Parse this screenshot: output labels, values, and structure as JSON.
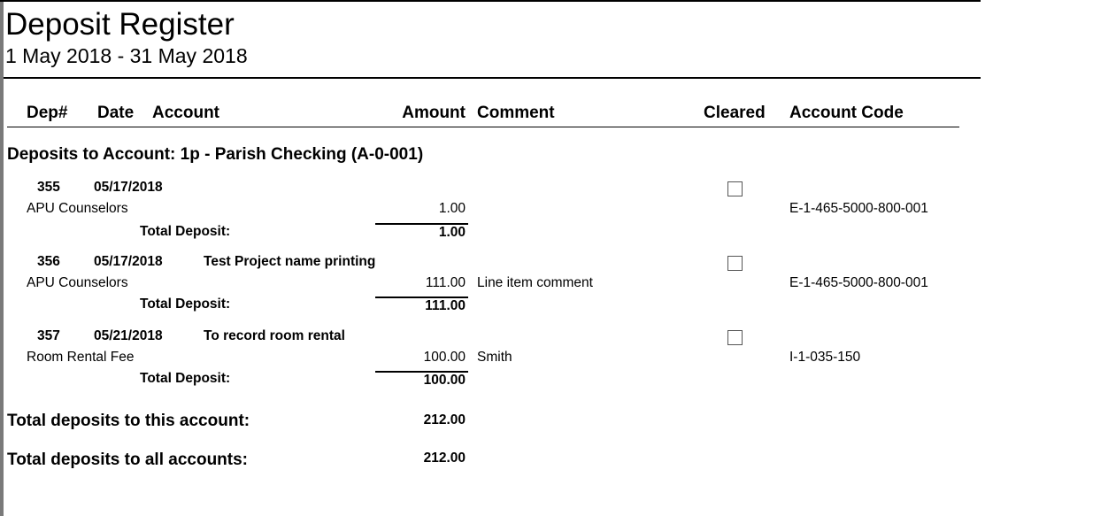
{
  "report": {
    "title": "Deposit Register",
    "date_range": "1 May 2018 - 31 May 2018"
  },
  "columns": {
    "dep": "Dep#",
    "date": "Date",
    "account": "Account",
    "amount": "Amount",
    "comment": "Comment",
    "cleared": "Cleared",
    "account_code": "Account Code"
  },
  "group": {
    "title": "Deposits to Account:  1p - Parish Checking (A-0-001)"
  },
  "deposits": [
    {
      "number": "355",
      "date": "05/17/2018",
      "description": "",
      "account": "APU Counselors",
      "amount": "1.00",
      "comment": "",
      "cleared": false,
      "account_code": "E-1-465-5000-800-001",
      "total_label": "Total Deposit:",
      "total": "1.00"
    },
    {
      "number": "356",
      "date": "05/17/2018",
      "description": "Test Project name printing",
      "account": "APU Counselors",
      "amount": "111.00",
      "comment": "Line item comment",
      "cleared": false,
      "account_code": "E-1-465-5000-800-001",
      "total_label": "Total Deposit:",
      "total": "111.00"
    },
    {
      "number": "357",
      "date": "05/21/2018",
      "description": "To record room rental",
      "account": "Room Rental Fee",
      "amount": "100.00",
      "comment": "Smith",
      "cleared": false,
      "account_code": "I-1-035-150",
      "total_label": "Total Deposit:",
      "total": "100.00"
    }
  ],
  "totals": {
    "account_label": "Total deposits to this account:",
    "account_total": "212.00",
    "all_label": "Total deposits to all accounts:",
    "all_total": "212.00"
  }
}
